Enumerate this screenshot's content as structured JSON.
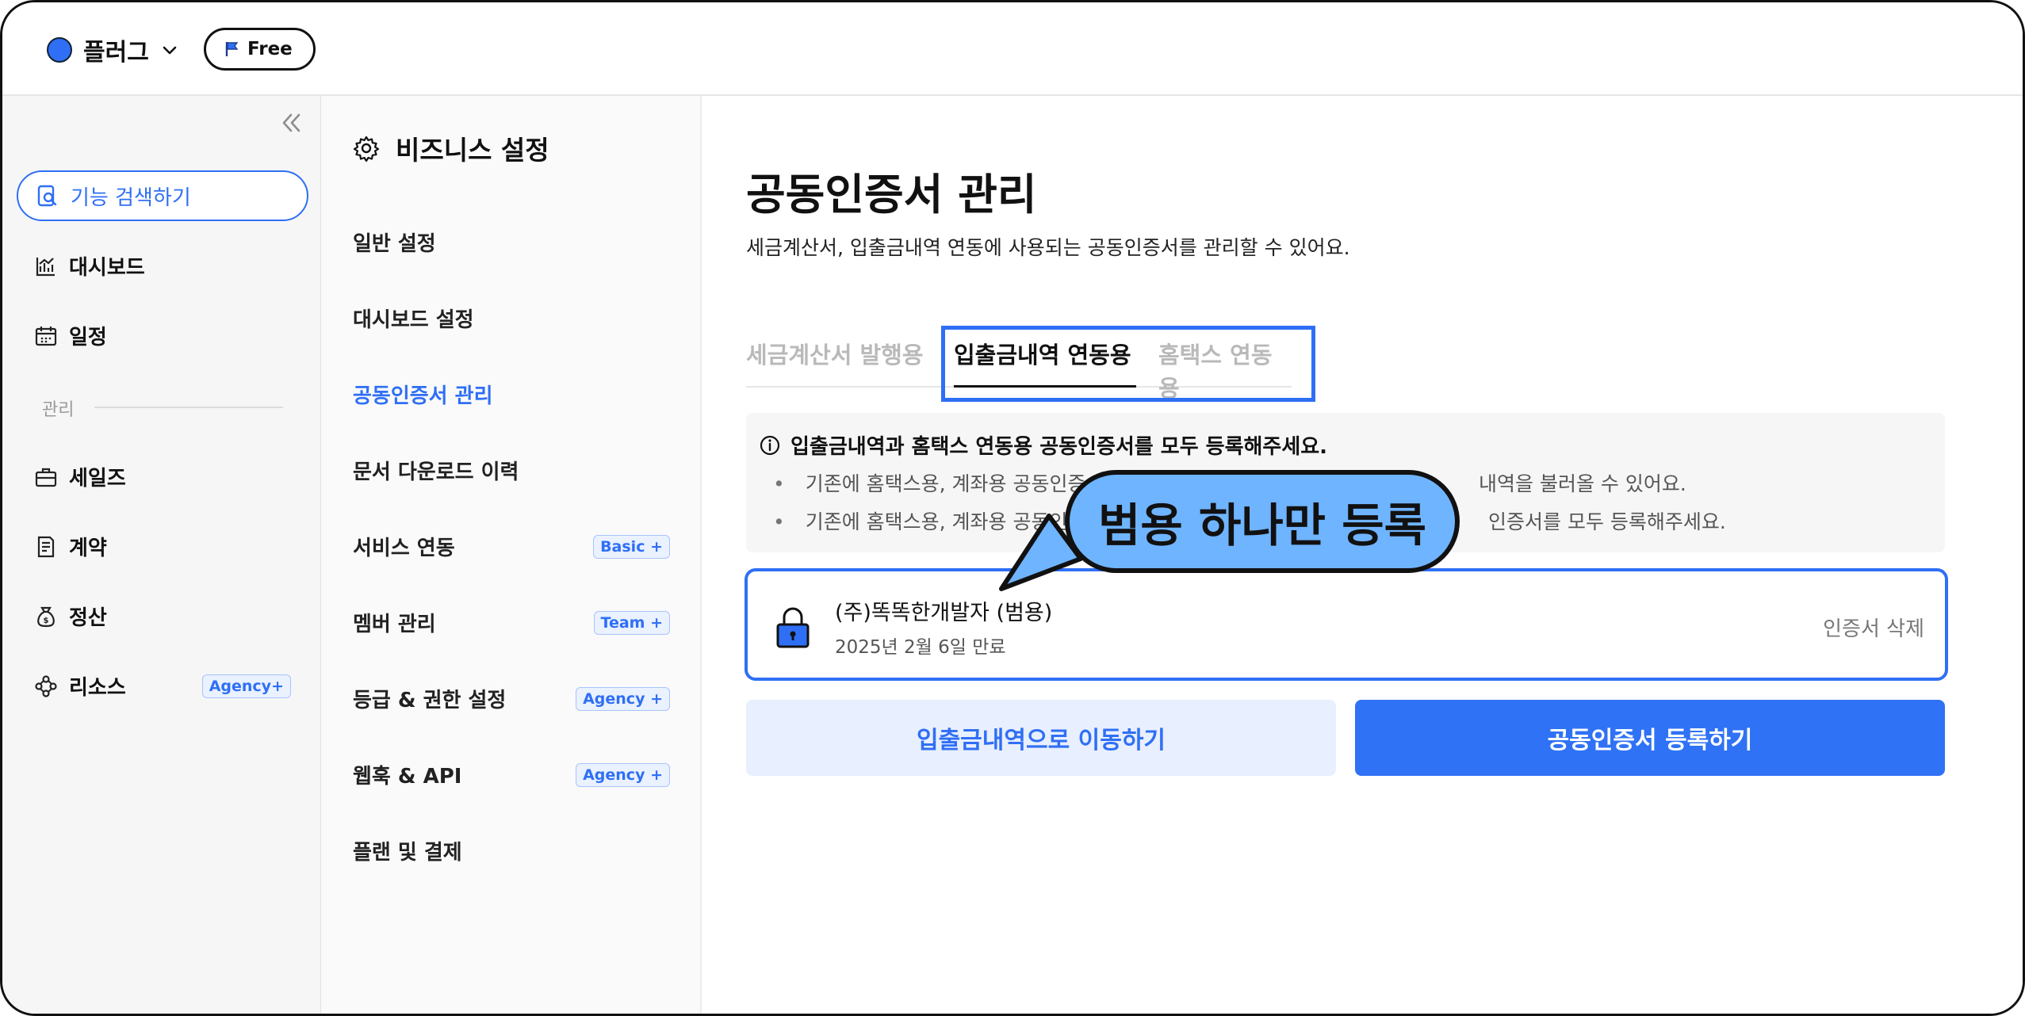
{
  "header": {
    "brand_name": "플러그",
    "plan_label": "Free"
  },
  "sidebar": {
    "search_label": "기능 검색하기",
    "items": [
      {
        "label": "대시보드"
      },
      {
        "label": "일정"
      },
      {
        "label": "세일즈"
      },
      {
        "label": "계약"
      },
      {
        "label": "정산"
      },
      {
        "label": "리소스",
        "badge": "Agency+"
      }
    ],
    "section_label": "관리"
  },
  "settings": {
    "title": "비즈니스 설정",
    "items": [
      {
        "label": "일반 설정"
      },
      {
        "label": "대시보드 설정"
      },
      {
        "label": "공동인증서 관리"
      },
      {
        "label": "문서 다운로드 이력"
      },
      {
        "label": "서비스 연동",
        "badge": "Basic +"
      },
      {
        "label": "멤버 관리",
        "badge": "Team +"
      },
      {
        "label": "등급 & 권한 설정",
        "badge": "Agency +"
      },
      {
        "label": "웹훅 & API",
        "badge": "Agency +"
      },
      {
        "label": "플랜 및 결제"
      }
    ]
  },
  "main": {
    "title": "공동인증서 관리",
    "description": "세금계산서, 입출금내역 연동에 사용되는 공동인증서를 관리할 수 있어요.",
    "tabs": [
      {
        "label": "세금계산서 발행용"
      },
      {
        "label": "입출금내역 연동용"
      },
      {
        "label": "홈택스 연동용"
      }
    ],
    "notice": {
      "heading": "입출금내역과 홈택스 연동용 공동인증서를 모두 등록해주세요.",
      "line1_left": "기존에 홈택스용, 계좌용 공동인증",
      "line1_right": "내역을 불러올 수 있어요.",
      "line2_left": "기존에 홈택스용, 계좌용 공동인",
      "line2_right": "인증서를 모두 등록해주세요."
    },
    "certificate": {
      "name": "(주)똑똑한개발자 (범용)",
      "expiry": "2025년 2월 6일 만료",
      "delete_label": "인증서 삭제"
    },
    "btn_go_transactions": "입출금내역으로 이동하기",
    "btn_register": "공동인증서 등록하기"
  },
  "callout": {
    "text": "범용 하나만 등록"
  },
  "colors": {
    "accent": "#2f6ff5",
    "callout": "#6fb4ff"
  }
}
